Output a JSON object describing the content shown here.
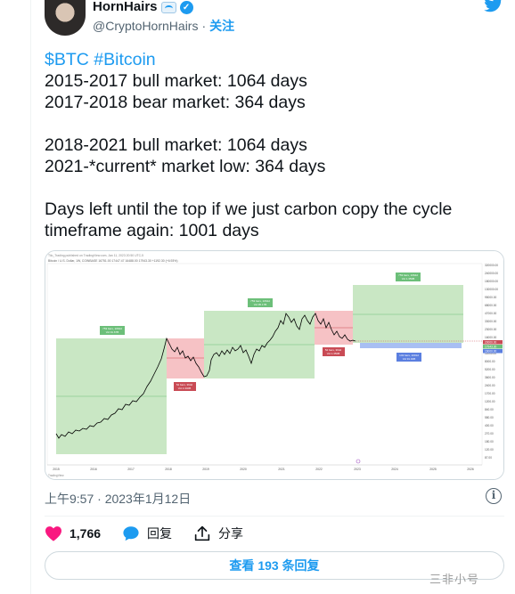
{
  "author": {
    "name": "HornHairs",
    "handle": "@CryptoHornHairs",
    "separator": "·",
    "follow_label": "关注"
  },
  "tweet": {
    "hashtags": "$BTC #Bitcoin",
    "lines": [
      "2015-2017 bull market: 1064 days",
      "2017-2018 bear market: 364 days",
      "",
      "2018-2021 bull market: 1064 days",
      "2021-*current* market low: 364 days",
      "",
      "Days left until the top if we just carbon copy the cycle",
      "timeframe again: 1001 days"
    ]
  },
  "chart_image": {
    "source_line": "Tilo_Trading published on TradingView.com, Jan 11, 2023 20:50 UTC-5",
    "symbol_line": "Bitcoin / U.S. Dollar, 1W, COINBASE 16751.00 17447.47 16488.00 17943.30 +1192.30 (+6.93%)",
    "tv_logo": "TradingView",
    "colors": {
      "bull_box": "#b7dfb0",
      "bear_box": "#f4b3b6",
      "projection_bar": "#9fb8f2",
      "label_green": "#6cbf79",
      "label_red": "#c94b55",
      "label_blue": "#5b7fe0",
      "price_line": "#000000"
    },
    "box_labels": [
      {
        "text": "753 bars, 1064d",
        "sub": "Vol 91.67B"
      },
      {
        "text": "52 bars, 364d",
        "sub": "Vol 4.340B"
      },
      {
        "text": "753 bars, 1064d",
        "sub": "Vol 95.17B"
      },
      {
        "text": "52 bars, 364d",
        "sub": "Vol 1.350B"
      },
      {
        "text": "753 bars, 1064d",
        "sub": "Vol 1.350B"
      },
      {
        "text": "143 bars, 1001d",
        "sub": "Vol 91.94B"
      }
    ],
    "x_ticks": [
      "2015",
      "2016",
      "2017",
      "2018",
      "2019",
      "2020",
      "2021",
      "2022",
      "2023",
      "2024",
      "2025",
      "2026"
    ],
    "y_ticks": [
      "320000.00",
      "240000.00",
      "180000.00",
      "130000.00",
      "95000.00",
      "68000.00",
      "47000.00",
      "33000.00",
      "23000.00",
      "16000.00",
      "11000.00",
      "8000.00",
      "5200.00",
      "3600.00",
      "2400.00",
      "1700.00",
      "1200.00",
      "840.00",
      "580.00",
      "400.00",
      "270.00",
      "180.00",
      "120.00",
      "87.00"
    ],
    "price_badges": [
      {
        "text": "20000.00",
        "color": "#c94b55"
      },
      {
        "text": "17943.30",
        "color": "#6cbf79"
      },
      {
        "text": "16000.00",
        "color": "#5b7fe0"
      }
    ]
  },
  "meta": {
    "timestamp": "上午9:57 · 2023年1月12日"
  },
  "actions": {
    "like_count": "1,766",
    "reply_label": "回复",
    "share_label": "分享"
  },
  "replies_button": {
    "prefix": "查看",
    "count": "193",
    "suffix": "条回复"
  },
  "watermark": "三非小号"
}
